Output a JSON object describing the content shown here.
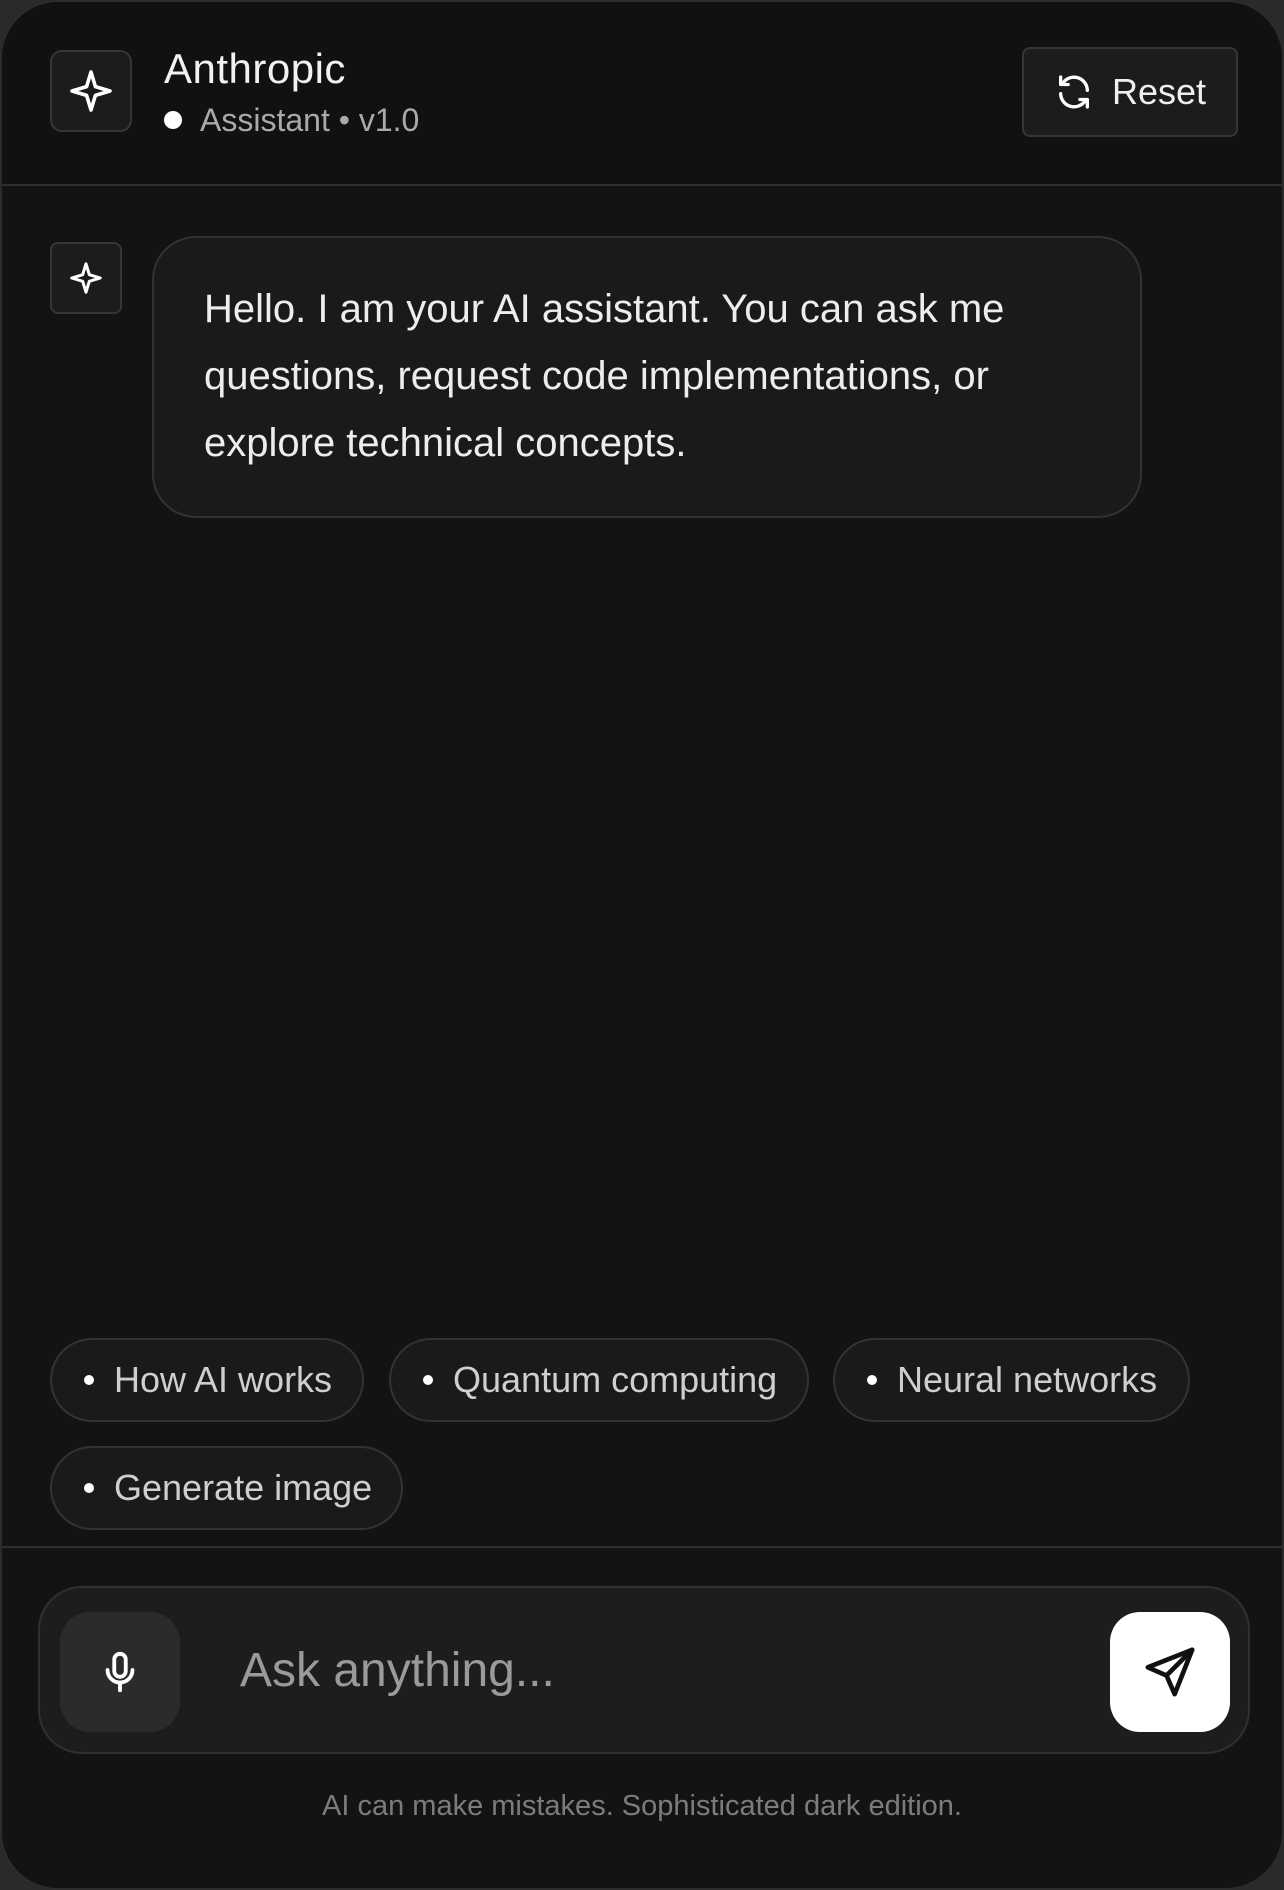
{
  "header": {
    "title": "Anthropic",
    "status_text": "Assistant • v1.0",
    "logo_icon": "sparkle-icon",
    "reset_label": "Reset",
    "reset_icon": "refresh-icon"
  },
  "messages": [
    {
      "role": "assistant",
      "avatar_icon": "sparkle-icon",
      "text": "Hello. I am your AI assistant. You can ask me questions, request code implementations, or explore technical concepts."
    }
  ],
  "suggestions": [
    {
      "label": "How AI works"
    },
    {
      "label": "Quantum computing"
    },
    {
      "label": "Neural networks"
    },
    {
      "label": "Generate image"
    }
  ],
  "input": {
    "value": "",
    "placeholder": "Ask anything...",
    "mic_icon": "microphone-icon",
    "send_icon": "send-icon"
  },
  "footer": {
    "disclaimer": "AI can make mistakes. Sophisticated dark edition."
  },
  "colors": {
    "background": "#131313",
    "surface": "#1c1c1c",
    "border": "#333333",
    "text_primary": "#ededed",
    "text_secondary": "#a9a9a9",
    "accent": "#ffffff"
  }
}
